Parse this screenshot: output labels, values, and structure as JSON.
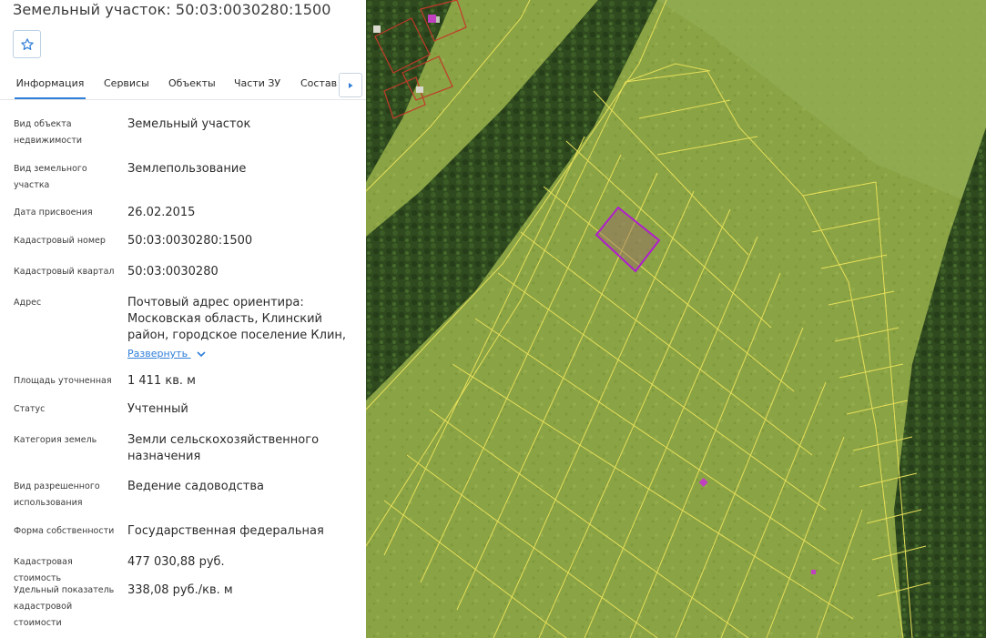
{
  "header": {
    "title": "Земельный участок: 50:03:0030280:1500"
  },
  "tabs": [
    {
      "label": "Информация"
    },
    {
      "label": "Сервисы"
    },
    {
      "label": "Объекты"
    },
    {
      "label": "Части ЗУ"
    },
    {
      "label": "Состав ЕЗП"
    }
  ],
  "fields": [
    {
      "label": "Вид объекта недвижимости",
      "value": "Земельный участок"
    },
    {
      "label": "Вид земельного участка",
      "value": "Землепользование"
    },
    {
      "label": "Дата присвоения",
      "value": "26.02.2015"
    },
    {
      "label": "Кадастровый номер",
      "value": "50:03:0030280:1500"
    },
    {
      "label": "Кадастровый квартал",
      "value": "50:03:0030280"
    },
    {
      "label": "Адрес",
      "value": "Почтовый адрес ориентира: Московская область, Клинский район, городское поселение Клин, д."
    },
    {
      "label": "Площадь уточненная",
      "value": "1 411 кв. м"
    },
    {
      "label": "Статус",
      "value": "Учтенный"
    },
    {
      "label": "Категория земель",
      "value": "Земли сельскохозяйственного назначения"
    },
    {
      "label": "Вид разрешенного использования",
      "value": "Ведение садоводства"
    },
    {
      "label": "Форма собственности",
      "value": "Государственная федеральная"
    },
    {
      "label": "Кадастровая стоимость",
      "value": "477 030,88 руб."
    },
    {
      "label": "Удельный показатель кадастровой стоимости",
      "value": "338,08 руб./кв. м"
    }
  ],
  "address_expand_label": "Развернуть",
  "icons": {
    "favorite": "star-icon",
    "tabs_scroll": "caret-right-icon",
    "expand": "chevron-down-icon"
  },
  "colors": {
    "accent": "#2f7ed8",
    "parcel_border": "#e6e05a",
    "selected_parcel": "#b01ecc"
  }
}
